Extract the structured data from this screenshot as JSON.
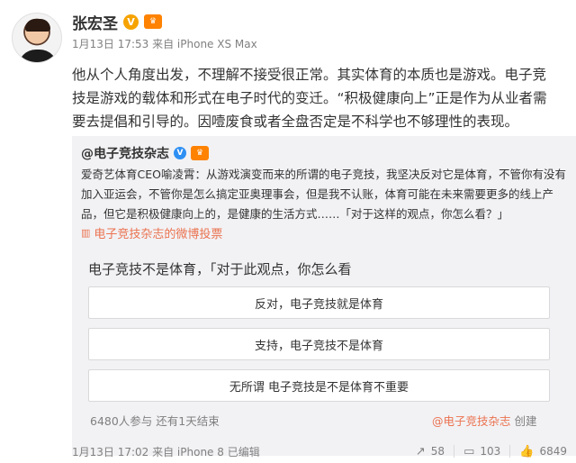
{
  "post": {
    "author": "张宏圣",
    "meta": "1月13日 17:53 来自 iPhone XS Max",
    "text": "他从个人角度出发，不理解不接受很正常。其实体育的本质也是游戏。电子竞技是游戏的载体和形式在电子时代的变迁。“积极健康向上”正是作为从业者需要去提倡和引导的。因噎废食或者全盘否定是不科学也不够理性的表现。"
  },
  "repost": {
    "author": "@电子竞技杂志",
    "text": "爱奇艺体育CEO喻凌霄：从游戏演变而来的所谓的电子竞技，我坚决反对它是体育，不管你有没有加入亚运会，不管你是怎么搞定亚奥理事会，但是我不认账，体育可能在未来需要更多的线上产品，但它是积极健康向上的，是健康的生活方式……「对于这样的观点，你怎么看？」",
    "vote_link": "电子竞技杂志的微博投票"
  },
  "vote": {
    "title": "电子竞技不是体育，「对于此观点，你怎么看",
    "options": [
      "反对，电子竞技就是体育",
      "支持，电子竞技不是体育",
      "无所谓 电子竞技是不是体育不重要"
    ],
    "participants": "6480人参与 还有1天结束",
    "creator": "@电子竞技杂志",
    "created_label": "创建"
  },
  "footer": {
    "meta": "1月13日 17:02 来自 iPhone 8 已编辑",
    "reposts": "58",
    "comments": "103",
    "likes": "6849"
  },
  "colors": {
    "link_orange": "#eb7350",
    "v_gold": "#f6a300",
    "v_blue": "#2e8ff3"
  },
  "icons": [
    "v-verified-icon",
    "vip-icon",
    "vote-icon",
    "repost-icon",
    "comment-icon",
    "like-icon"
  ]
}
